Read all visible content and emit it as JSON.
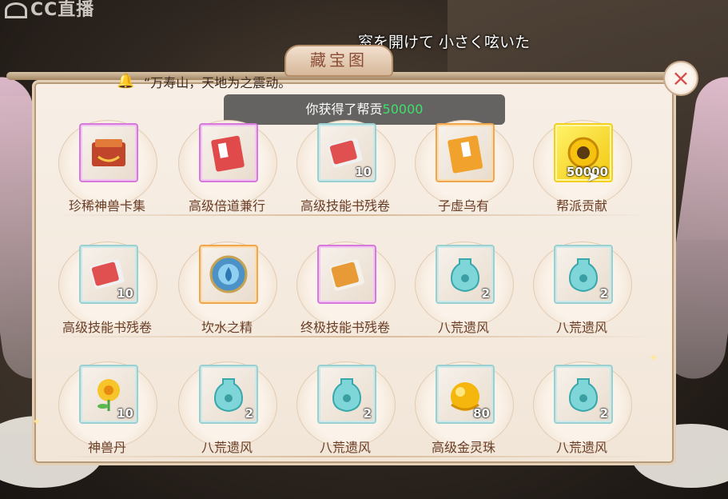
{
  "watermark": "CC直播",
  "subtitle": "窓を開けて 小さく呟いた",
  "window": {
    "title": "藏宝图",
    "close_label": "×"
  },
  "announcement": {
    "text": "“万寿山，天地为之震动。"
  },
  "toast": {
    "prefix": "你获得了帮贡",
    "amount": "50000"
  },
  "colors": {
    "accent_green": "#3ee06a",
    "label_brown": "#6a3d26",
    "close_red": "#d84b4b"
  },
  "rewards": [
    [
      {
        "name": "珍稀神兽卡集",
        "qty": "",
        "icon": "beast-card-box-icon",
        "rarity": "purple"
      },
      {
        "name": "高级倍道兼行",
        "qty": "",
        "icon": "red-scroll-book-icon",
        "rarity": "purple"
      },
      {
        "name": "高级技能书残卷",
        "qty": "10",
        "icon": "skill-book-fragment-icon",
        "rarity": "teal"
      },
      {
        "name": "子虚乌有",
        "qty": "",
        "icon": "orange-book-icon",
        "rarity": "orange"
      },
      {
        "name": "帮派贡献",
        "qty": "50000",
        "icon": "guild-contribution-icon",
        "rarity": "gold"
      }
    ],
    [
      {
        "name": "高级技能书残卷",
        "qty": "10",
        "icon": "skill-book-fragment-icon",
        "rarity": "teal"
      },
      {
        "name": "坎水之精",
        "qty": "",
        "icon": "water-essence-icon",
        "rarity": "orange"
      },
      {
        "name": "终极技能书残卷",
        "qty": "",
        "icon": "ultimate-skill-book-icon",
        "rarity": "purple"
      },
      {
        "name": "八荒遗风",
        "qty": "2",
        "icon": "jade-vase-icon",
        "rarity": "teal"
      },
      {
        "name": "八荒遗风",
        "qty": "2",
        "icon": "jade-vase-icon",
        "rarity": "teal"
      }
    ],
    [
      {
        "name": "神兽丹",
        "qty": "10",
        "icon": "golden-flower-icon",
        "rarity": "teal"
      },
      {
        "name": "八荒遗风",
        "qty": "2",
        "icon": "jade-vase-icon",
        "rarity": "teal"
      },
      {
        "name": "八荒遗风",
        "qty": "2",
        "icon": "jade-vase-icon",
        "rarity": "teal"
      },
      {
        "name": "高级金灵珠",
        "qty": "80",
        "icon": "gold-spirit-pearl-icon",
        "rarity": "teal"
      },
      {
        "name": "八荒遗风",
        "qty": "2",
        "icon": "jade-vase-icon",
        "rarity": "teal"
      }
    ]
  ]
}
